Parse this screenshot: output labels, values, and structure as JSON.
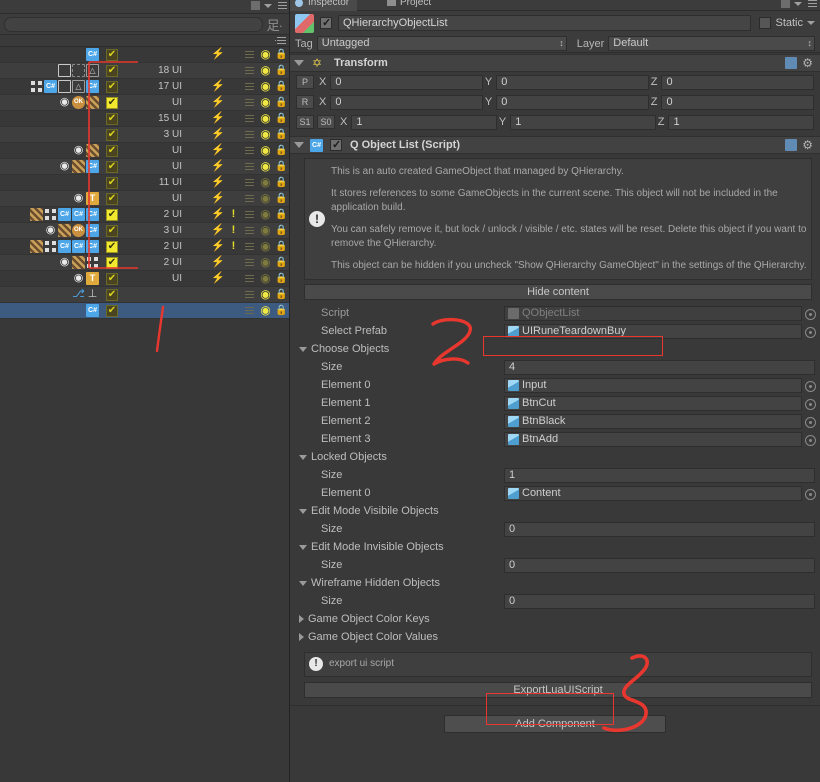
{
  "app": "Unity Editor",
  "hierarchy": {
    "search": {
      "placeholder": "",
      "value": ""
    },
    "cjk_icon_label": "足·",
    "rows": [
      {
        "label": "",
        "checked": false,
        "icons": [
          "cs-script-icon"
        ],
        "bolt": true,
        "bars": true,
        "eye": "bright",
        "lock": "off"
      },
      {
        "label": "18 UI",
        "checked": false,
        "icons": [
          "box-collider-icon",
          "dashed-rect-icon",
          "mesh-icon"
        ],
        "bolt": false,
        "bars": true,
        "eye": "bright",
        "lock": "off"
      },
      {
        "label": "17 UI",
        "checked": false,
        "icons": [
          "grid-icon",
          "cs-script-icon",
          "box-collider-icon",
          "mesh-icon",
          "cs-script-icon"
        ],
        "bolt": true,
        "bars": true,
        "eye": "bright",
        "lock": "off"
      },
      {
        "label": "UI",
        "checked": true,
        "icons": [
          "eye-icon",
          "ok-badge-icon",
          "texture-icon"
        ],
        "bolt": true,
        "bars": true,
        "eye": "bright",
        "lock": "off"
      },
      {
        "label": "15 UI",
        "checked": false,
        "icons": [],
        "bolt": true,
        "bars": true,
        "eye": "bright",
        "lock": "on"
      },
      {
        "label": "3 UI",
        "checked": false,
        "icons": [],
        "bolt": true,
        "bars": true,
        "eye": "bright",
        "lock": "off"
      },
      {
        "label": "UI",
        "checked": false,
        "icons": [
          "eye-icon",
          "texture-icon"
        ],
        "bolt": true,
        "bars": true,
        "eye": "bright",
        "lock": "off"
      },
      {
        "label": "UI",
        "checked": false,
        "icons": [
          "eye-icon",
          "texture-icon",
          "cs-script-icon"
        ],
        "bolt": true,
        "bars": true,
        "eye": "bright",
        "lock": "off"
      },
      {
        "label": "11 UI",
        "checked": false,
        "icons": [],
        "bolt": true,
        "bars": true,
        "eye": "dim",
        "lock": "off"
      },
      {
        "label": "UI",
        "checked": false,
        "icons": [
          "eye-icon",
          "text-icon"
        ],
        "bolt": true,
        "bars": true,
        "eye": "dim",
        "lock": "off"
      },
      {
        "label": "2 UI",
        "checked": true,
        "icons": [
          "texture-icon",
          "grid-icon",
          "cs-script-icon",
          "cs-script-icon",
          "cs-script-icon"
        ],
        "bolt": true,
        "bang": true,
        "bars": true,
        "eye": "dim",
        "lock": "off"
      },
      {
        "label": "3 UI",
        "checked": false,
        "icons": [
          "eye-icon",
          "texture-icon",
          "ok-badge-icon",
          "cs-script-icon"
        ],
        "bolt": true,
        "bang": true,
        "bars": true,
        "eye": "dim",
        "lock": "off"
      },
      {
        "label": "2 UI",
        "checked": true,
        "icons": [
          "texture-icon",
          "grid-icon",
          "cs-script-icon",
          "cs-script-icon",
          "cs-script-icon"
        ],
        "bolt": true,
        "bang": true,
        "bars": true,
        "eye": "dim",
        "lock": "off"
      },
      {
        "label": "2 UI",
        "checked": true,
        "icons": [
          "eye-icon",
          "texture-icon",
          "grid-icon"
        ],
        "bolt": true,
        "bars": true,
        "eye": "dim",
        "lock": "off"
      },
      {
        "label": "UI",
        "checked": false,
        "icons": [
          "eye-icon",
          "text-icon"
        ],
        "bolt": true,
        "bars": true,
        "eye": "dim",
        "lock": "off"
      },
      {
        "label": "",
        "checked": false,
        "icons": [
          "joystick-icon",
          "axis-icon"
        ],
        "bolt": false,
        "bars": true,
        "eye": "bright",
        "lock": "off"
      },
      {
        "label": "",
        "checked": false,
        "selected": true,
        "icons": [
          "cs-script-icon"
        ],
        "bolt": false,
        "bars": true,
        "eye": "bright",
        "lock": "off"
      }
    ]
  },
  "inspector": {
    "tabs": [
      {
        "label": "Inspector",
        "active": true,
        "icon": "inspector-icon"
      },
      {
        "label": "Project",
        "active": false,
        "icon": "project-icon"
      }
    ],
    "gameobject": {
      "enabled": true,
      "name": "QHierarchyObjectList",
      "static_label": "Static",
      "static_checked": false,
      "tag_label": "Tag",
      "tag_value": "Untagged",
      "layer_label": "Layer",
      "layer_value": "Default"
    },
    "transform": {
      "title": "Transform",
      "rows": [
        {
          "btns": [
            "P"
          ],
          "fields": [
            {
              "axis": "X",
              "value": "0"
            },
            {
              "axis": "Y",
              "value": "0"
            },
            {
              "axis": "Z",
              "value": "0"
            }
          ]
        },
        {
          "btns": [
            "R"
          ],
          "fields": [
            {
              "axis": "X",
              "value": "0"
            },
            {
              "axis": "Y",
              "value": "0"
            },
            {
              "axis": "Z",
              "value": "0"
            }
          ]
        },
        {
          "btns": [
            "S1",
            "S0"
          ],
          "fields": [
            {
              "axis": "X",
              "value": "1"
            },
            {
              "axis": "Y",
              "value": "1"
            },
            {
              "axis": "Z",
              "value": "1"
            }
          ]
        }
      ]
    },
    "script_component": {
      "title": "Q Object List (Script)",
      "enabled": true,
      "help_paragraphs": [
        "This is an auto created GameObject that managed by QHierarchy.",
        "It stores references to some GameObjects in the current scene. This object will not be included in the application build.",
        "You can safely remove it, but lock / unlock / visible / etc. states will be reset. Delete this object if you want to remove the QHierarchy.",
        "This object can be hidden if you uncheck \"Show QHierarchy GameObject\" in the settings of the QHierarchy."
      ],
      "hide_content_label": "Hide content",
      "properties": [
        {
          "kind": "object",
          "label": "Script",
          "indent": 1,
          "value": "QObjectList",
          "dim": true
        },
        {
          "kind": "object",
          "label": "Select Prefab",
          "indent": 1,
          "value": "UIRuneTeardownBuy",
          "dim": false,
          "highlight": true
        },
        {
          "kind": "foldout",
          "label": "Choose Objects",
          "open": true,
          "indent": 0
        },
        {
          "kind": "number",
          "label": "Size",
          "indent": 1,
          "value": "4"
        },
        {
          "kind": "object",
          "label": "Element 0",
          "indent": 1,
          "value": "Input"
        },
        {
          "kind": "object",
          "label": "Element 1",
          "indent": 1,
          "value": "BtnCut"
        },
        {
          "kind": "object",
          "label": "Element 2",
          "indent": 1,
          "value": "BtnBlack"
        },
        {
          "kind": "object",
          "label": "Element 3",
          "indent": 1,
          "value": "BtnAdd"
        },
        {
          "kind": "foldout",
          "label": "Locked Objects",
          "open": true,
          "indent": 0
        },
        {
          "kind": "number",
          "label": "Size",
          "indent": 1,
          "value": "1"
        },
        {
          "kind": "object",
          "label": "Element 0",
          "indent": 1,
          "value": "Content"
        },
        {
          "kind": "foldout",
          "label": "Edit Mode Visibile Objects",
          "open": true,
          "indent": 0
        },
        {
          "kind": "number",
          "label": "Size",
          "indent": 1,
          "value": "0"
        },
        {
          "kind": "foldout",
          "label": "Edit Mode Invisible Objects",
          "open": true,
          "indent": 0
        },
        {
          "kind": "number",
          "label": "Size",
          "indent": 1,
          "value": "0"
        },
        {
          "kind": "foldout",
          "label": "Wireframe Hidden Objects",
          "open": true,
          "indent": 0
        },
        {
          "kind": "number",
          "label": "Size",
          "indent": 1,
          "value": "0"
        },
        {
          "kind": "foldout",
          "label": "Game Object Color Keys",
          "open": false,
          "indent": 0
        },
        {
          "kind": "foldout",
          "label": "Game Object Color Values",
          "open": false,
          "indent": 0
        }
      ],
      "export_help": "export ui script",
      "export_button": "ExportLuaUIScript"
    },
    "add_component_label": "Add Component"
  },
  "annotations": {
    "accent_color": "#e8372e",
    "marks": [
      {
        "name": "hierarchy-bracket",
        "type": "bracket"
      },
      {
        "name": "hierarchy-tail-stroke",
        "type": "stroke"
      },
      {
        "name": "numeral-2",
        "type": "digit",
        "text": "2"
      },
      {
        "name": "select-prefab-box",
        "type": "box"
      },
      {
        "name": "numeral-3",
        "type": "digit",
        "text": "3"
      },
      {
        "name": "export-button-box",
        "type": "box"
      }
    ]
  }
}
